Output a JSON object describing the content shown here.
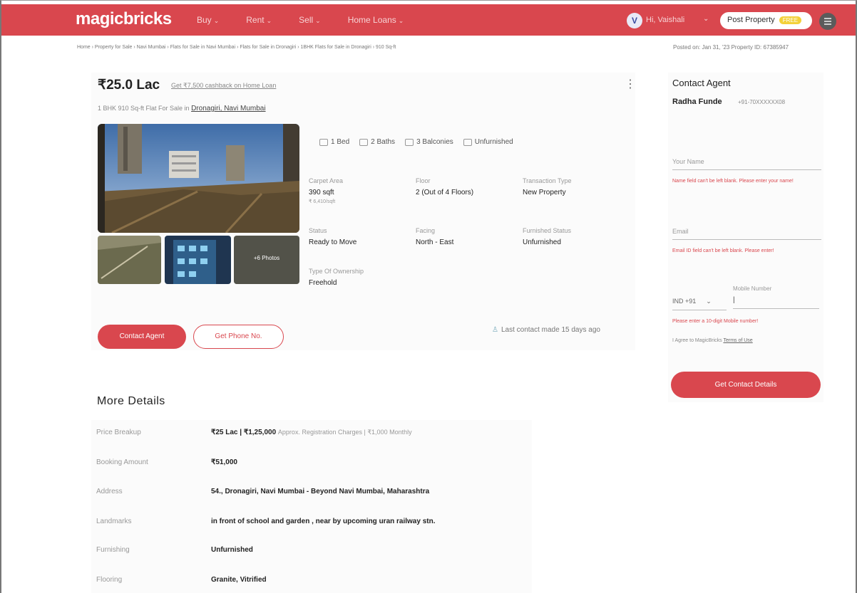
{
  "nav": {
    "logo": "magicbricks",
    "items": [
      {
        "label": "Buy"
      },
      {
        "label": "Rent"
      },
      {
        "label": "Sell"
      },
      {
        "label": "Home Loans"
      }
    ],
    "user_initial": "V",
    "user_greeting": "Hi, Vaishali",
    "post_property_label": "Post Property",
    "post_property_badge": "FREE"
  },
  "breadcrumb": "Home › Property for Sale › Navi Mumbai › Flats for Sale in Navi Mumbai › Flats for Sale in Dronagiri › 1BHK Flats for Sale in Dronagiri › 910 Sq-ft",
  "posted_info": "Posted on: Jan 31, '23     Property ID: 67385947",
  "listing": {
    "price": "₹25.0 Lac",
    "cashback_link": "Get ₹7,500 cashback on Home Loan",
    "subtitle_prefix": "1 BHK 910 Sq-ft Flat For Sale in",
    "location_link": "Dronagiri, Navi Mumbai",
    "more_photos": "+6 Photos",
    "amenities": [
      {
        "label": "1 Bed",
        "icon": "bed-icon"
      },
      {
        "label": "2 Baths",
        "icon": "bath-icon"
      },
      {
        "label": "3 Balconies",
        "icon": "balcony-icon"
      },
      {
        "label": "Unfurnished",
        "icon": "furniture-icon"
      }
    ],
    "specs": {
      "carpet_area_label": "Carpet Area",
      "carpet_area_value": "390 sqft",
      "carpet_area_sub": "₹ 6,410/sqft",
      "floor_label": "Floor",
      "floor_value": "2 (Out of 4 Floors)",
      "transaction_label": "Transaction Type",
      "transaction_value": "New Property",
      "status_label": "Status",
      "status_value": "Ready to Move",
      "facing_label": "Facing",
      "facing_value": "North - East",
      "furnished_label": "Furnished Status",
      "furnished_value": "Unfurnished",
      "ownership_label": "Type Of Ownership",
      "ownership_value": "Freehold"
    },
    "contact_agent_label": "Contact Agent",
    "get_phone_label": "Get Phone No.",
    "last_contact": "Last contact made 15 days ago"
  },
  "side": {
    "title": "Contact Agent",
    "agent_name": "Radha Funde",
    "agent_phone": "+91-70XXXXXX08",
    "name_placeholder": "Your Name",
    "name_error": "Name field can't be left blank. Please enter your name!",
    "email_placeholder": "Email",
    "email_error": "Email ID field can't be left blank. Please enter!",
    "country_code": "IND +91",
    "mobile_label": "Mobile Number",
    "mobile_value": "|",
    "mobile_error": "Please enter a 10-digit Mobile number!",
    "terms_prefix": "I Agree to MagicBricks",
    "terms_link": "Terms of Use",
    "cta_label": "Get Contact Details"
  },
  "more_details": {
    "title": "More Details",
    "rows": [
      {
        "label": "Price Breakup",
        "value": "₹25 Lac | ₹1,25,000",
        "extra": "Approx. Registration Charges | ₹1,000 Monthly"
      },
      {
        "label": "Booking Amount",
        "value": "₹51,000",
        "extra": ""
      },
      {
        "label": "Address",
        "value": "54., Dronagiri, Navi Mumbai - Beyond Navi Mumbai, Maharashtra",
        "extra": ""
      },
      {
        "label": "Landmarks",
        "value": "in front of school and garden , near by upcoming uran railway stn.",
        "extra": ""
      },
      {
        "label": "Furnishing",
        "value": "Unfurnished",
        "extra": ""
      },
      {
        "label": "Flooring",
        "value": "Granite, Vitrified",
        "extra": ""
      }
    ]
  },
  "colors": {
    "brand_red": "#d9474e",
    "free_badge": "#f3d13a"
  }
}
